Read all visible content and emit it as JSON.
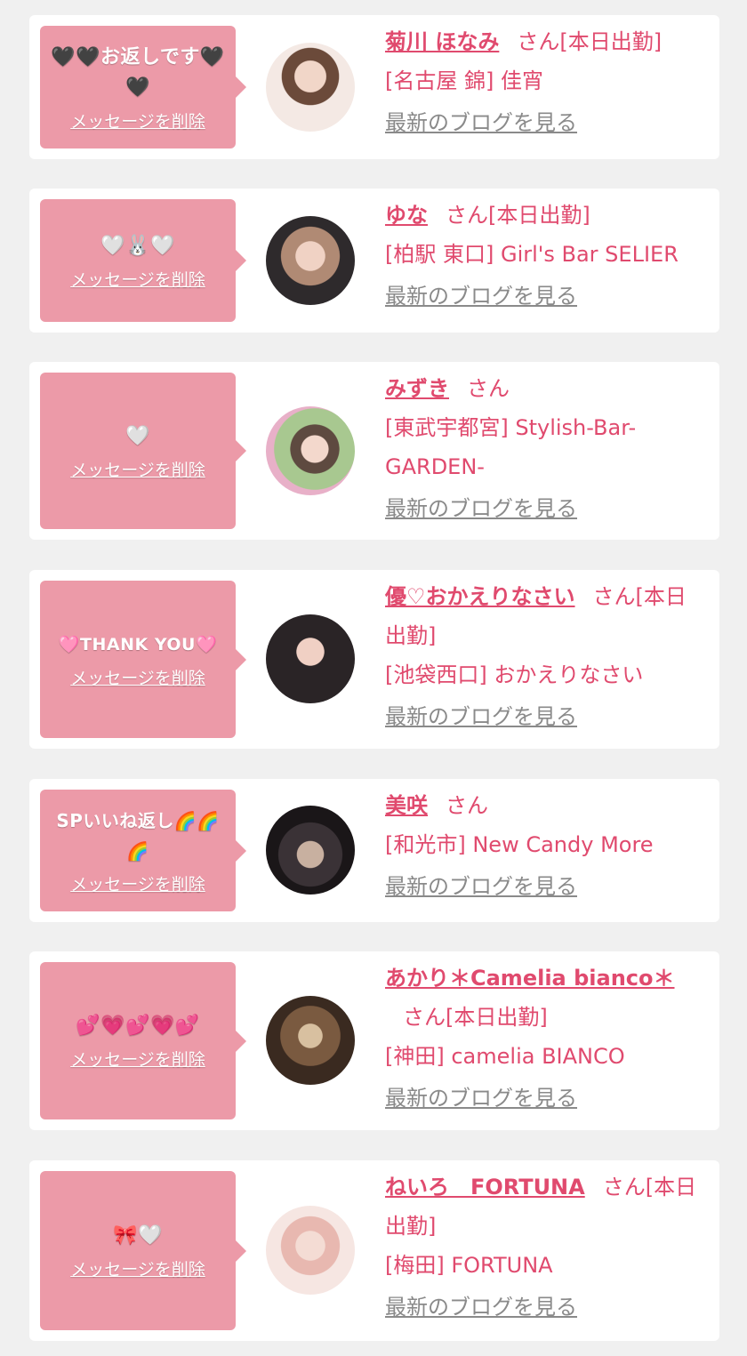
{
  "colors": {
    "background": "#f0f0f0",
    "card": "#ffffff",
    "bubble": "#ec9aa8",
    "accent": "#e04a6e",
    "blog_link": "#8a8a8a"
  },
  "items": [
    {
      "message": "🖤🖤お返しです🖤🖤",
      "delete_label": "メッセージを削除",
      "avatar_icon": "avatar-photo",
      "name": "菊川 ほなみ",
      "suffix": "さん[本日出勤]",
      "shop": "[名古屋 錦] 佳宵",
      "blog_label": "最新のブログを見る"
    },
    {
      "message": "🤍🐰🤍",
      "delete_label": "メッセージを削除",
      "avatar_icon": "avatar-photo",
      "name": "ゆな",
      "suffix": "さん[本日出勤]",
      "shop": "[柏駅 東口] Girl's Bar SELIER",
      "blog_label": "最新のブログを見る"
    },
    {
      "message": "🤍",
      "delete_label": "メッセージを削除",
      "avatar_icon": "avatar-photo",
      "name": "みずき",
      "suffix": "さん",
      "shop": "[東武宇都宮] Stylish-Bar-GARDEN-",
      "blog_label": "最新のブログを見る"
    },
    {
      "message": "🩷THANK YOU🩷",
      "delete_label": "メッセージを削除",
      "avatar_icon": "avatar-photo",
      "name": "優♡おかえりなさい",
      "suffix": "さん[本日出勤]",
      "shop": "[池袋西口] おかえりなさい",
      "blog_label": "最新のブログを見る"
    },
    {
      "message": "SPいいね返し🌈🌈🌈",
      "delete_label": "メッセージを削除",
      "avatar_icon": "avatar-photo",
      "name": "美咲",
      "suffix": "さん",
      "shop": "[和光市] New Candy More",
      "blog_label": "最新のブログを見る"
    },
    {
      "message": "💕💗💕💗💕",
      "delete_label": "メッセージを削除",
      "avatar_icon": "avatar-photo",
      "name": "あかり＊Camelia bianco＊",
      "suffix": "さん[本日出勤]",
      "shop": "[神田] camelia BIANCO",
      "blog_label": "最新のブログを見る"
    },
    {
      "message": "🎀🤍",
      "delete_label": "メッセージを削除",
      "avatar_icon": "avatar-photo",
      "name": "ねいろ　FORTUNA",
      "suffix": "さん[本日出勤]",
      "shop": "[梅田] FORTUNA",
      "blog_label": "最新のブログを見る"
    }
  ]
}
